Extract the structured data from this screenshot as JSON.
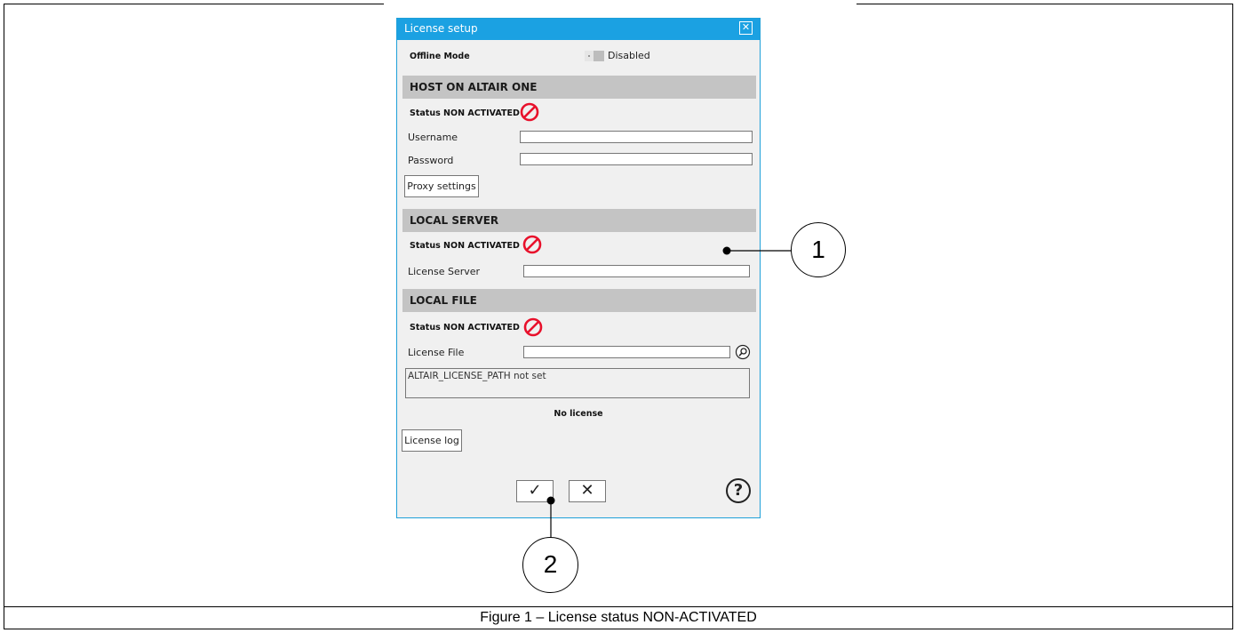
{
  "dialog": {
    "title": "License setup",
    "offline_mode": {
      "label": "Offline Mode",
      "state": "Disabled"
    },
    "host": {
      "header": "HOST ON ALTAIR ONE",
      "status": "Status NON ACTIVATED",
      "username_label": "Username",
      "password_label": "Password",
      "username_value": "",
      "password_value": "",
      "proxy_button": "Proxy settings"
    },
    "local_server": {
      "header": "LOCAL SERVER",
      "status": "Status NON ACTIVATED",
      "server_label": "License Server",
      "server_value": ""
    },
    "local_file": {
      "header": "LOCAL FILE",
      "status": "Status NON ACTIVATED",
      "file_label": "License File",
      "file_value": "",
      "message": "ALTAIR_LICENSE_PATH not set"
    },
    "license_status": "No license",
    "log_button": "License log",
    "ok_glyph": "✓",
    "cancel_glyph": "✕",
    "help_glyph": "?"
  },
  "callouts": {
    "one": "1",
    "two": "2"
  },
  "caption": "Figure 1 – License status NON-ACTIVATED",
  "colors": {
    "titlebar": "#1ba1e2",
    "section": "#c4c4c4",
    "status_icon": "#e8102b"
  },
  "icons": {
    "close": "close-icon",
    "status": "not-activated-icon",
    "browse": "search-icon",
    "help": "help-icon"
  }
}
